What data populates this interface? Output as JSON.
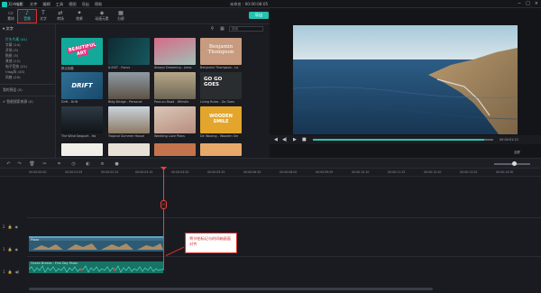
{
  "app": {
    "name": "万兴喵影",
    "menu": [
      "文件",
      "编辑",
      "工具",
      "视图",
      "导出",
      "帮助"
    ],
    "doc_title": "未命名 : 00:00:08:05",
    "export_label": "导出"
  },
  "toolbar": {
    "items": [
      {
        "icon": "folder-icon",
        "label": "素材"
      },
      {
        "icon": "music-icon",
        "label": "音频"
      },
      {
        "icon": "text-icon",
        "label": "文字"
      },
      {
        "icon": "transition-icon",
        "label": "转场"
      },
      {
        "icon": "effects-icon",
        "label": "效果"
      },
      {
        "icon": "elements-icon",
        "label": "动画元素"
      },
      {
        "icon": "split-screen-icon",
        "label": "分屏"
      }
    ],
    "active_index": 1
  },
  "library": {
    "header": "文字",
    "categories": [
      "片头片尾 (41)",
      "字幕 (14)",
      "开场 (3)",
      "贴纸 (3)",
      "其他 (12)",
      "电子竞技 (21)",
      "Vlog风 (43)",
      "风格 (20)"
    ],
    "selected_index": 0,
    "extra_item": "我的预设 (0)",
    "checkbox_label": "智能搜索来源 (0)"
  },
  "grid": {
    "search_placeholder": "搜索",
    "tiles": [
      {
        "label": "默认标题",
        "thumb": "BEAUTIFUL ART"
      },
      {
        "label": "A-EXIT - Focus",
        "thumb": ""
      },
      {
        "label": "Always Dreaming - Jump",
        "thumb": ""
      },
      {
        "label": "Benjamin Thompson - La",
        "thumb": "Benjamin Thompson"
      },
      {
        "label": "Drift - Drift",
        "thumb": "DRIFT"
      },
      {
        "label": "Bldg Bridge - Personal",
        "thumb": ""
      },
      {
        "label": "Post-on-Road - Whistle",
        "thumb": ""
      },
      {
        "label": "Living Rules - Go Goes",
        "thumb": "GO GO GOES"
      },
      {
        "label": "The Wind Seaport - Ha",
        "thumb": ""
      },
      {
        "label": "Tropical Summer House",
        "thumb": ""
      },
      {
        "label": "Wedding Love Plans",
        "thumb": ""
      },
      {
        "label": "Dir Wooing - Wooden Sm",
        "thumb": "WOODEN SMILE"
      }
    ]
  },
  "preview": {
    "time_readout": "00:00:01:13",
    "zoom_label": "全屏"
  },
  "timeline": {
    "ticks": [
      "00:00:00:00",
      "00:00:01:05",
      "00:00:02:10",
      "00:00:03:15",
      "00:00:04:20",
      "00:00:05:25",
      "00:00:06:30",
      "00:00:08:00",
      "00:00:09:05",
      "00:00:10:10",
      "00:00:11:15",
      "00:00:12:20",
      "00:00:13:25",
      "00:00:14:30"
    ],
    "video_clip_label": "Plage",
    "audio_clip_label": "Ocean Breeze - Fine Day Music",
    "track_labels": [
      "2",
      "1",
      "1"
    ],
    "callout_text": "将节拍标记与时间轴画面对齐"
  }
}
